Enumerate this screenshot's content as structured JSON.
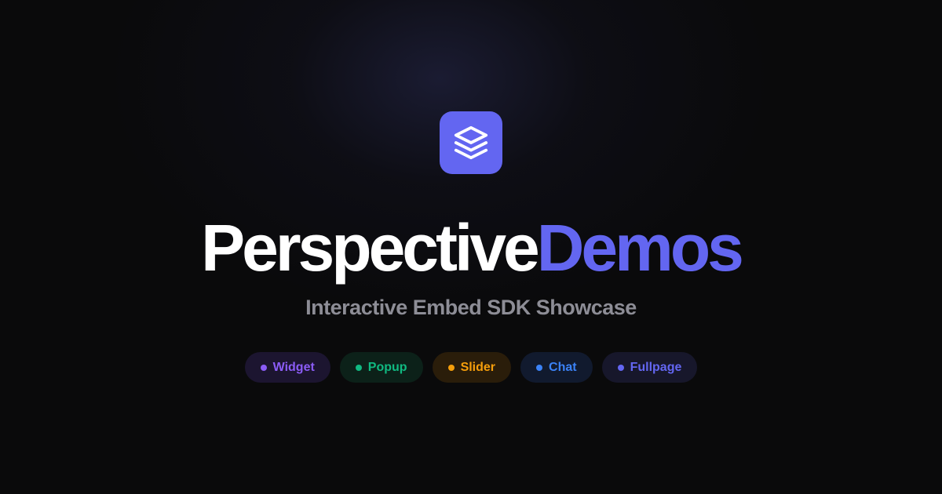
{
  "brand": {
    "logo_icon": "layers-icon",
    "accent_color": "#6366f1",
    "title_part1": "Perspective",
    "title_part2": "Demos"
  },
  "subtitle": "Interactive Embed SDK Showcase",
  "pills": [
    {
      "label": "Widget",
      "color": "#8b5cf6",
      "bg": "#1c1530"
    },
    {
      "label": "Popup",
      "color": "#10b981",
      "bg": "#0c2119"
    },
    {
      "label": "Slider",
      "color": "#f59e0b",
      "bg": "#2a1d0a"
    },
    {
      "label": "Chat",
      "color": "#3b82f6",
      "bg": "#111a2e"
    },
    {
      "label": "Fullpage",
      "color": "#6366f1",
      "bg": "#17172b"
    }
  ]
}
